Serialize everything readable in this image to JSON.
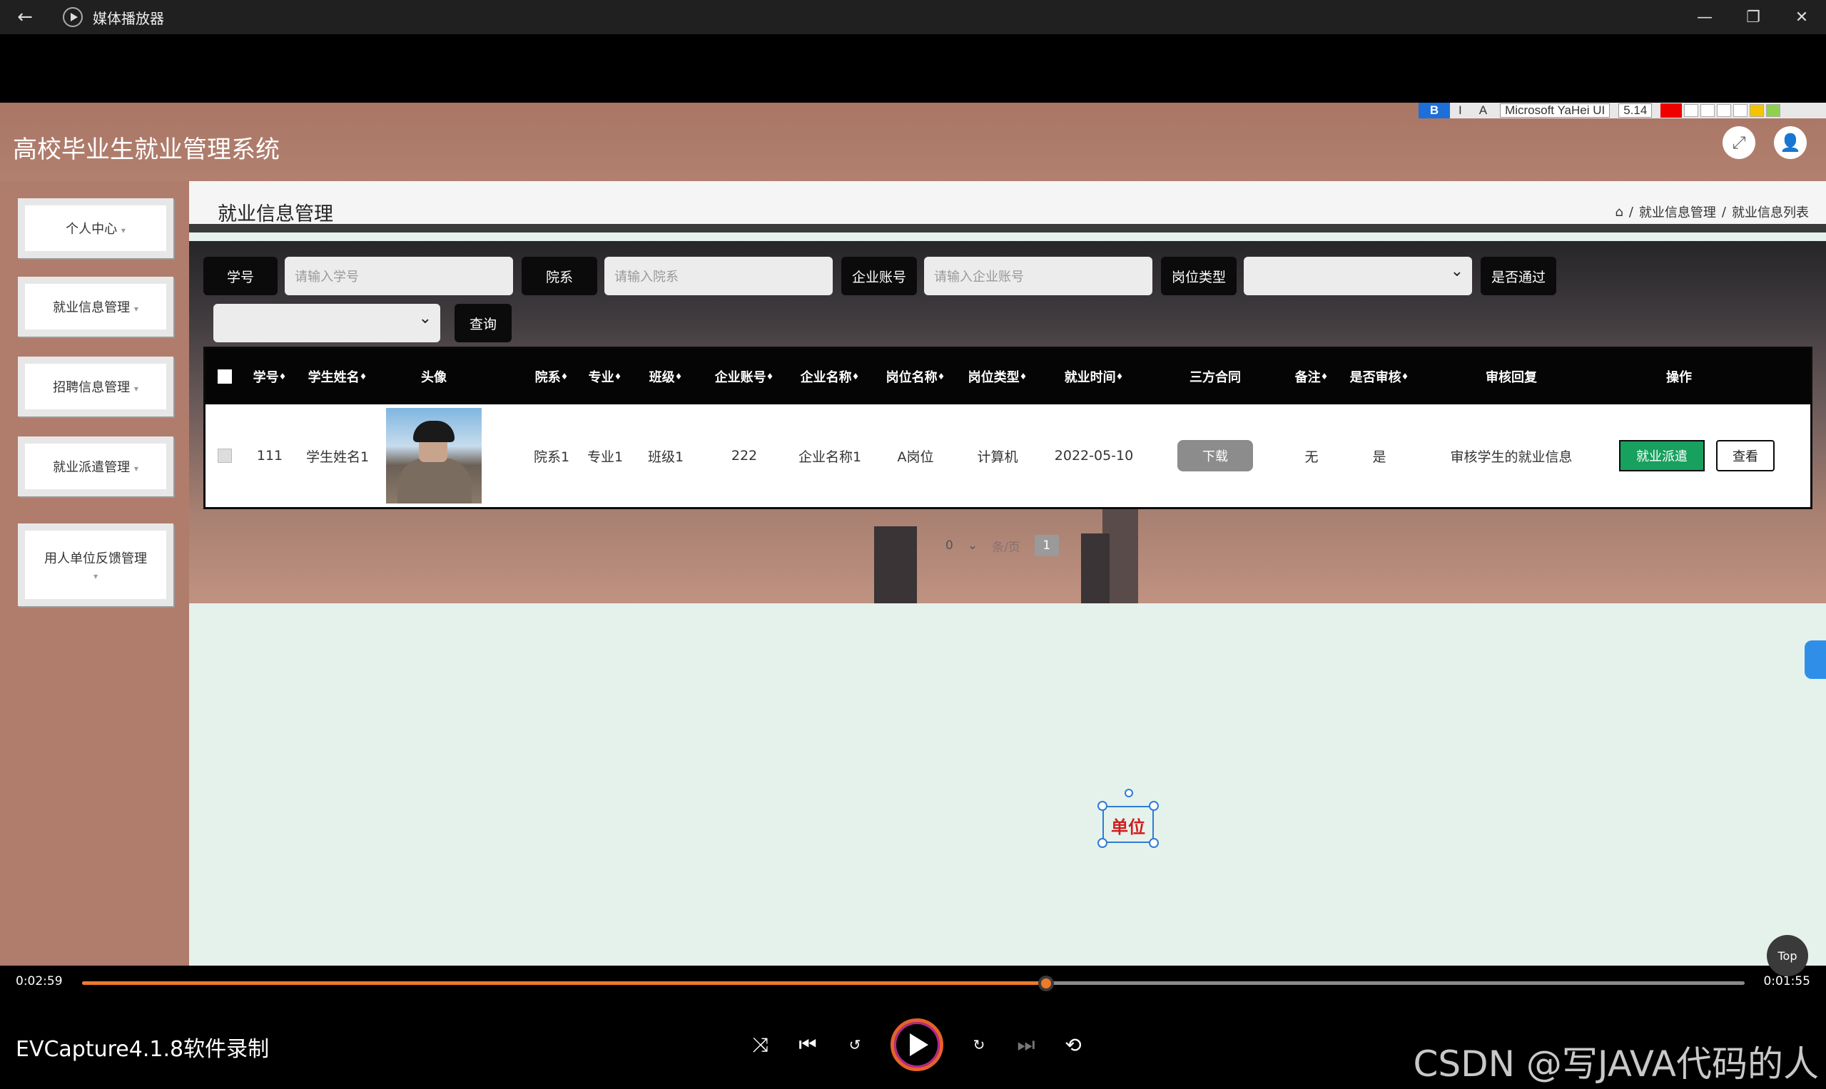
{
  "window": {
    "title": "媒体播放器",
    "controls": [
      "—",
      "❐",
      "✕"
    ]
  },
  "editor_toolbar": {
    "bold": "B",
    "italic": "I",
    "font": "Microsoft YaHei UI",
    "size": "5.14"
  },
  "app": {
    "title": "高校毕业生就业管理系统",
    "page_title": "就业信息管理",
    "breadcrumb": [
      "就业信息管理",
      "就业信息列表"
    ],
    "breadcrumb_sep": "/"
  },
  "sidebar": {
    "items": [
      {
        "label": "个人中心"
      },
      {
        "label": "就业信息管理"
      },
      {
        "label": "招聘信息管理"
      },
      {
        "label": "就业派遣管理"
      },
      {
        "label": "用人单位反馈管理"
      }
    ],
    "caret": "▾"
  },
  "search": {
    "student_no_label": "学号",
    "student_no_placeholder": "请输入学号",
    "dept_label": "院系",
    "dept_placeholder": "请输入院系",
    "company_account_label": "企业账号",
    "company_account_placeholder": "请输入企业账号",
    "job_type_label": "岗位类型",
    "approved_label": "是否通过",
    "query_button": "查询"
  },
  "table": {
    "headers": [
      "学号",
      "学生姓名",
      "头像",
      "院系",
      "专业",
      "班级",
      "企业账号",
      "企业名称",
      "岗位名称",
      "岗位类型",
      "就业时间",
      "三方合同",
      "备注",
      "是否审核",
      "审核回复",
      "操作"
    ],
    "sort_mark": "♦",
    "rows": [
      {
        "student_no": "111",
        "student_name": "学生姓名1",
        "dept": "院系1",
        "major": "专业1",
        "class": "班级1",
        "company_account": "222",
        "company_name": "企业名称1",
        "job_name": "A岗位",
        "job_type": "计算机",
        "employ_date": "2022-05-10",
        "contract_button": "下载",
        "remark": "无",
        "reviewed": "是",
        "review_reply": "审核学生的就业信息",
        "action_dispatch": "就业派遣",
        "action_view": "查看"
      }
    ]
  },
  "pagination": {
    "total": "0",
    "page_size_hint": "条/页",
    "current_page": "1"
  },
  "canvas_annotation": {
    "text": "单位"
  },
  "player": {
    "elapsed": "0:02:59",
    "remaining": "0:01:55",
    "progress_fraction": 0.58,
    "recorder_label": "EVCapture4.1.8软件录制",
    "watermark": "CSDN @写JAVA代码的人",
    "top_button": "Top"
  },
  "colors": {
    "accent": "#f07a2a",
    "dispatch_green": "#17a05e",
    "header_brown": "#b07c6c"
  }
}
